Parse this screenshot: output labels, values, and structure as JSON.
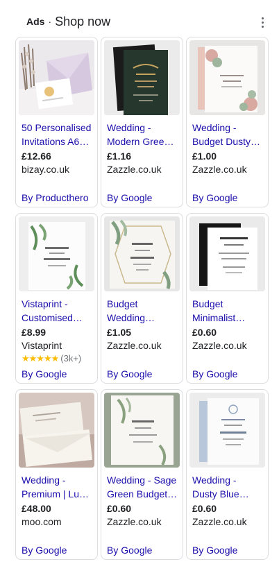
{
  "header": {
    "ads_label": "Ads",
    "separator": "·",
    "title": "Shop now",
    "menu_icon": "more-vert-icon"
  },
  "products": [
    {
      "title": "50 Personalised Invitations A6…",
      "price": "£12.66",
      "merchant": "bizay.co.uk",
      "byline": "By Producthero"
    },
    {
      "title": "Wedding - Modern Gree…",
      "price": "£1.16",
      "merchant": "Zazzle.co.uk",
      "byline": "By Google"
    },
    {
      "title": "Wedding - Budget Dusty…",
      "price": "£1.00",
      "merchant": "Zazzle.co.uk",
      "byline": "By Google"
    },
    {
      "title": "Vistaprint - Customised…",
      "price": "£8.99",
      "merchant": "Vistaprint",
      "rating": {
        "stars": "★★★★★",
        "count": "(3k+)",
        "value": 4.5
      },
      "byline": "By Google"
    },
    {
      "title": "Budget Wedding…",
      "price": "£1.05",
      "merchant": "Zazzle.co.uk",
      "byline": "By Google"
    },
    {
      "title": "Budget Minimalist…",
      "price": "£0.60",
      "merchant": "Zazzle.co.uk",
      "byline": "By Google"
    },
    {
      "title": "Wedding - Premium | Lu…",
      "price": "£48.00",
      "merchant": "moo.com",
      "byline": "By Google"
    },
    {
      "title": "Wedding - Sage Green Budget…",
      "price": "£0.60",
      "merchant": "Zazzle.co.uk",
      "byline": "By Google"
    },
    {
      "title": "Wedding - Dusty Blue…",
      "price": "£0.60",
      "merchant": "Zazzle.co.uk",
      "byline": "By Google"
    }
  ],
  "colors": {
    "link": "#1a0dab",
    "text": "#202124",
    "border": "#dadce0",
    "star": "#fbbc04"
  }
}
